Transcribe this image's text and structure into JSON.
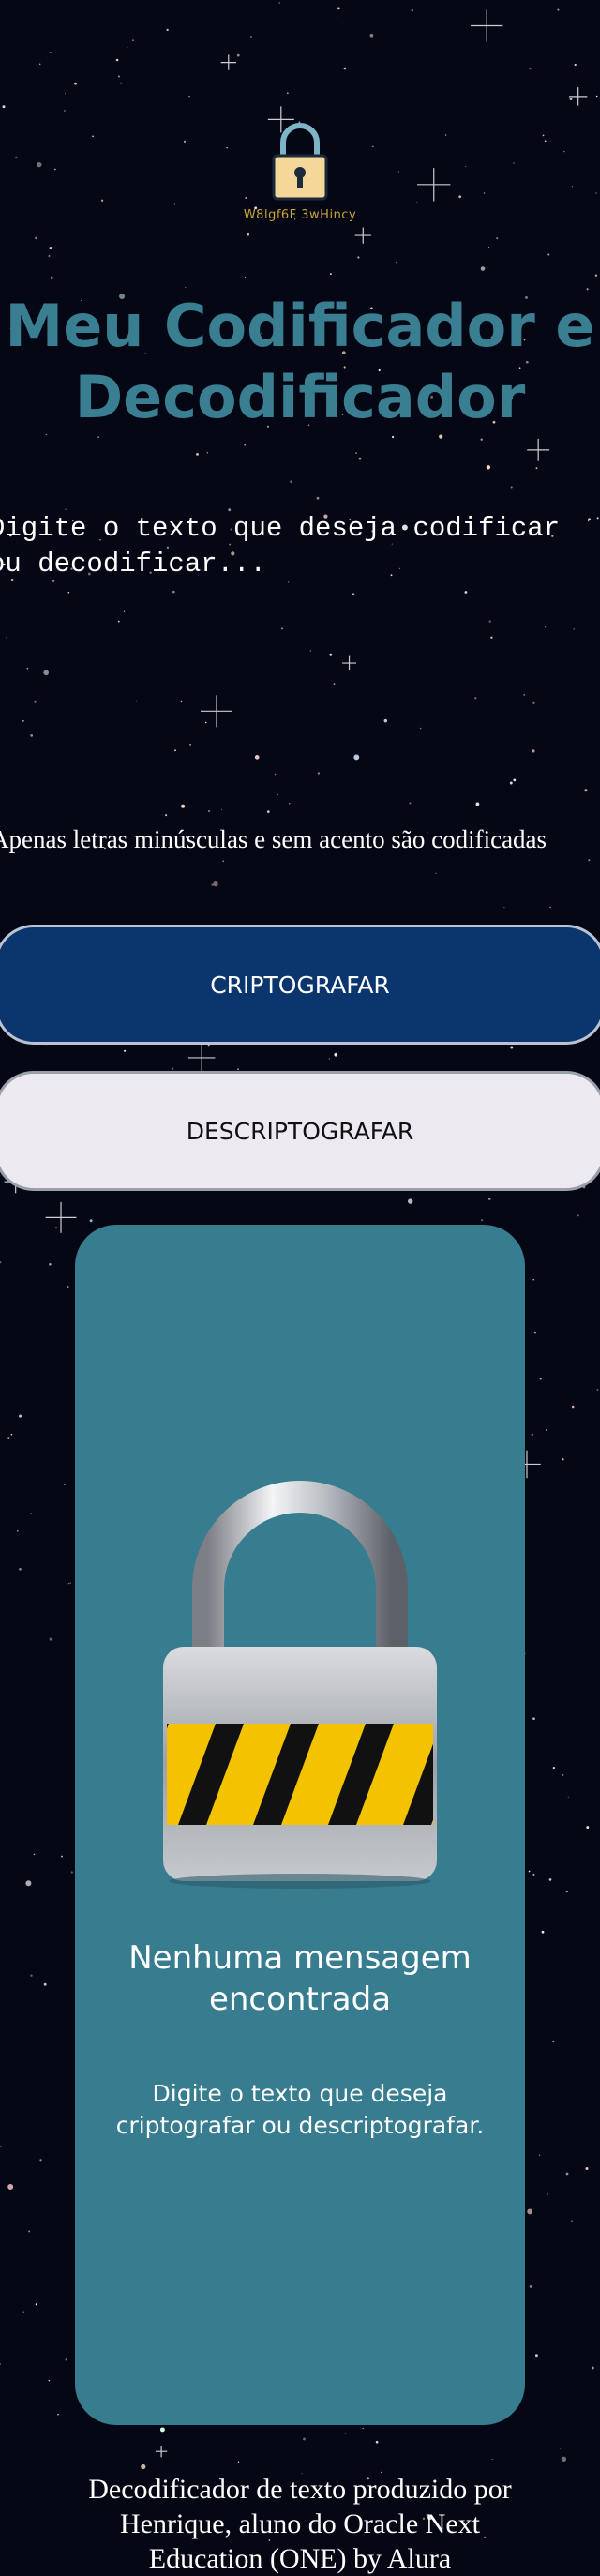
{
  "logo": {
    "icon": "padlock-icon",
    "text": "W8lgf6F 3wHincy"
  },
  "header": {
    "title": "Meu Codificador e Decodificador"
  },
  "input": {
    "placeholder": "Digite o texto que deseja codificar ou decodificar...",
    "value": ""
  },
  "hint": {
    "icon": "info-icon",
    "text": "Apenas letras minúsculas e sem acento são codificadas"
  },
  "buttons": {
    "encrypt_label": "CRIPTOGRAFAR",
    "decrypt_label": "DESCRIPTOGRAFAR"
  },
  "output": {
    "image": "padlock-illustration",
    "empty_title": "Nenhuma mensagem encontrada",
    "empty_desc": "Digite o texto que deseja criptografar ou descriptografar."
  },
  "footer": {
    "text": "Decodificador de texto produzido por Henrique, aluno do Oracle Next Education (ONE) by Alura"
  },
  "colors": {
    "background": "#050814",
    "title": "#3a7e92",
    "encrypt_button": "#0b356d",
    "decrypt_button": "#eceaf0",
    "card": "#387c90"
  }
}
